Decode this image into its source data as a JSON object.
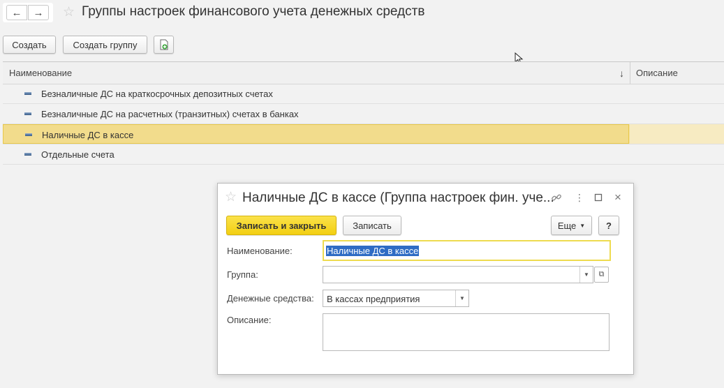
{
  "header": {
    "back_icon": "arrow-left-icon",
    "forward_icon": "arrow-right-icon",
    "favorite_icon": "star-outline-icon",
    "title": "Группы настроек финансового учета денежных средств"
  },
  "toolbar": {
    "create_label": "Создать",
    "create_group_label": "Создать группу",
    "add_copy_icon": "document-add-icon"
  },
  "table": {
    "columns": [
      {
        "label": "Наименование",
        "sort_icon": "↓"
      },
      {
        "label": "Описание"
      }
    ],
    "rows": [
      {
        "name": "Безналичные ДС на краткосрочных депозитных счетах",
        "description": "",
        "selected": false
      },
      {
        "name": "Безналичные ДС на расчетных (транзитных) счетах в банках",
        "description": "",
        "selected": false
      },
      {
        "name": "Наличные ДС в кассе",
        "description": "",
        "selected": true
      },
      {
        "name": "Отдельные счета",
        "description": "",
        "selected": false
      }
    ]
  },
  "dialog": {
    "title": "Наличные ДС в кассе (Группа настроек фин. уче...",
    "save_close_label": "Записать и закрыть",
    "save_label": "Записать",
    "more_label": "Еще",
    "help_label": "?",
    "fields": {
      "name_label": "Наименование:",
      "name_value": "Наличные ДС в кассе",
      "group_label": "Группа:",
      "group_value": "",
      "money_label": "Денежные средства:",
      "money_value": "В кассах предприятия",
      "description_label": "Описание:",
      "description_value": ""
    }
  },
  "colors": {
    "accent_yellow": "#f2cf12",
    "selected_row": "#f5e2a0",
    "selection_blue": "#2f6cc4",
    "background": "#f2f2f2"
  }
}
